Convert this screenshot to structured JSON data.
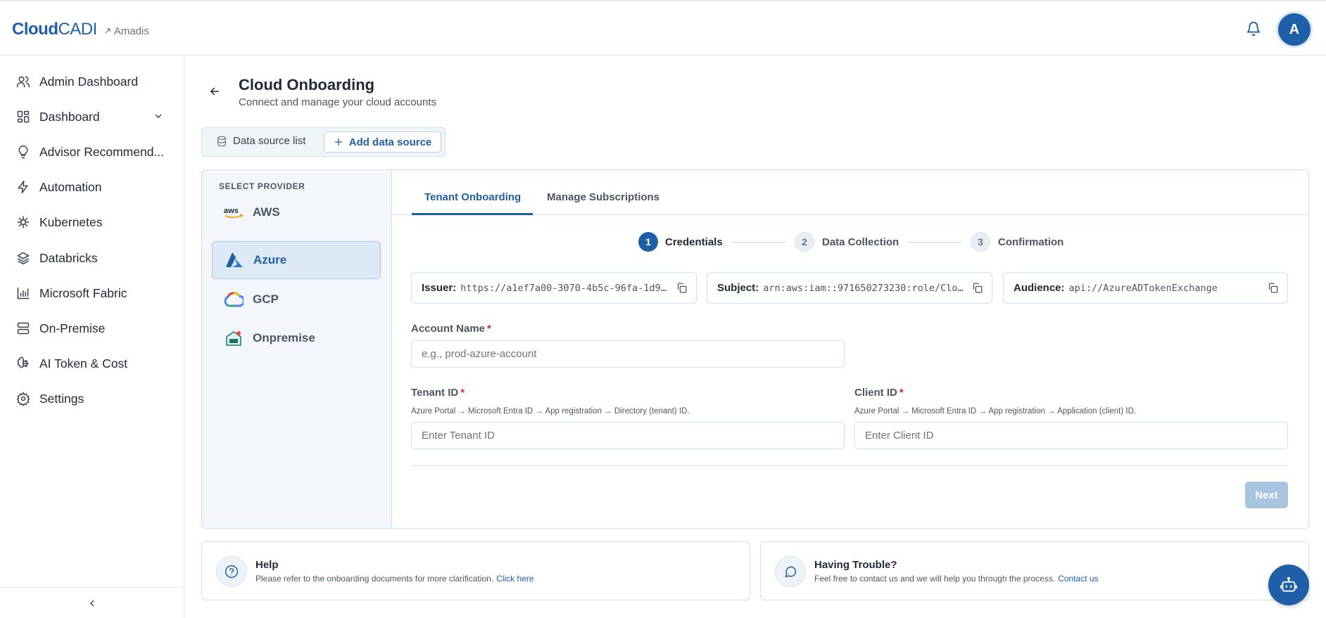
{
  "header": {
    "brand_bold": "Cloud",
    "brand_light": "CADI",
    "org_name": "Amadis",
    "avatar_initial": "A"
  },
  "sidebar": {
    "items": [
      {
        "label": "Admin Dashboard",
        "icon": "users-icon"
      },
      {
        "label": "Dashboard",
        "icon": "dashboard-icon"
      },
      {
        "label": "Advisor Recommend...",
        "icon": "lightbulb-icon"
      },
      {
        "label": "Automation",
        "icon": "lightning-icon"
      },
      {
        "label": "Kubernetes",
        "icon": "helm-icon"
      },
      {
        "label": "Databricks",
        "icon": "layers-icon"
      },
      {
        "label": "Microsoft Fabric",
        "icon": "bar-chart-icon"
      },
      {
        "label": "On-Premise",
        "icon": "server-icon"
      },
      {
        "label": "AI Token & Cost",
        "icon": "brain-icon"
      },
      {
        "label": "Settings",
        "icon": "gear-icon"
      }
    ]
  },
  "page": {
    "title": "Cloud Onboarding",
    "subtitle": "Connect and manage your cloud accounts"
  },
  "segment": {
    "data_source_list": "Data source list",
    "add_data_source": "Add data source"
  },
  "providers": {
    "heading": "SELECT PROVIDER",
    "items": [
      {
        "label": "AWS",
        "active": false
      },
      {
        "label": "Azure",
        "active": true
      },
      {
        "label": "GCP",
        "active": false
      },
      {
        "label": "Onpremise",
        "active": false
      }
    ]
  },
  "tabs": [
    {
      "label": "Tenant Onboarding",
      "active": true
    },
    {
      "label": "Manage Subscriptions",
      "active": false
    }
  ],
  "steps": [
    {
      "num": "1",
      "label": "Credentials",
      "active": true
    },
    {
      "num": "2",
      "label": "Data Collection",
      "active": false
    },
    {
      "num": "3",
      "label": "Confirmation",
      "active": false
    }
  ],
  "info": {
    "issuer_key": "Issuer:",
    "issuer_value": "https://a1ef7a00-3070-4b5c-96fa-1d99...",
    "subject_key": "Subject:",
    "subject_value": "arn:aws:iam::971650273230:role/Clou...",
    "audience_key": "Audience:",
    "audience_value": "api://AzureADTokenExchange"
  },
  "form": {
    "account_name_label": "Account Name",
    "account_name_placeholder": "e.g., prod-azure-account",
    "tenant_label": "Tenant ID",
    "tenant_help": "Azure Portal → Microsoft Entra ID → App registration → Directory (tenant) ID.",
    "tenant_placeholder": "Enter Tenant ID",
    "client_label": "Client ID",
    "client_help": "Azure Portal → Microsoft Entra ID → App registration → Application (client) ID.",
    "client_placeholder": "Enter Client ID",
    "required_mark": "*",
    "next_label": "Next"
  },
  "help_card": {
    "title": "Help",
    "desc": "Please refer to the onboarding documents for more clarification.",
    "link": "Click here"
  },
  "trouble_card": {
    "title": "Having Trouble?",
    "desc": "Feel free to contact us and we will help you through the process.",
    "link": "Contact us"
  },
  "colors": {
    "primary": "#1f5fa8",
    "required": "#dc2626",
    "next_disabled": "#a8c4e0"
  }
}
